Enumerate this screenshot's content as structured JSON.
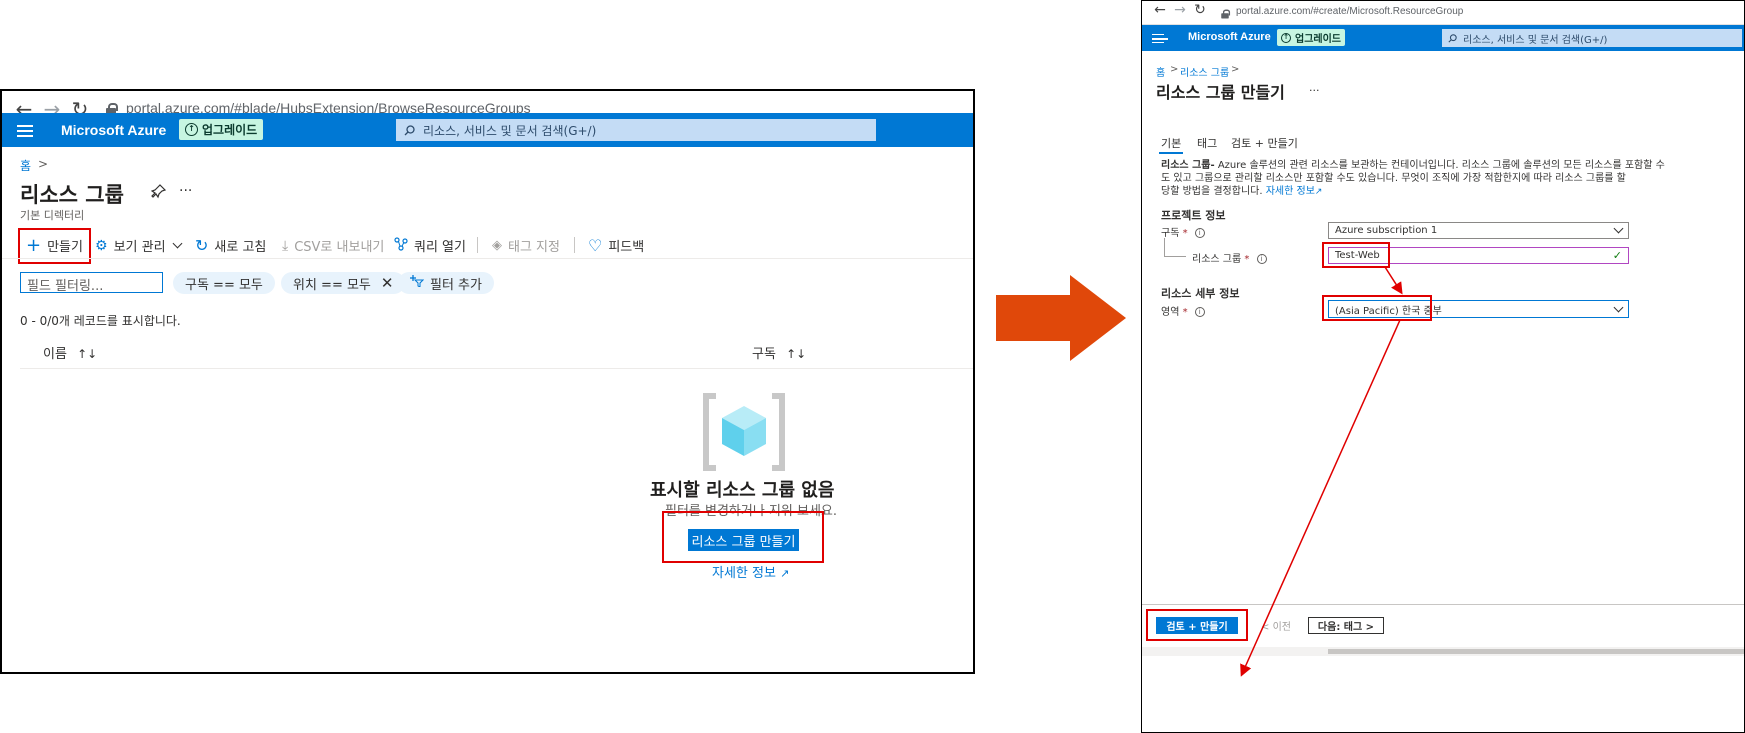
{
  "left": {
    "browser": {
      "url": "portal.azure.com/#blade/HubsExtension/BrowseResourceGroups"
    },
    "topbar": {
      "brand": "Microsoft Azure",
      "upgrade": "업그레이드",
      "search_placeholder": "리소스, 서비스 및 문서 검색(G+/)"
    },
    "breadcrumb": {
      "home": "홈",
      "sep": ">"
    },
    "title": "리소스 그룹",
    "subtitle": "기본 디렉터리",
    "ellipsis": "···",
    "toolbar": {
      "create": "만들기",
      "manage_view": "보기 관리",
      "refresh": "새로 고침",
      "export_csv": "CSV로 내보내기",
      "open_query": "쿼리 열기",
      "assign_tags": "태그 지정",
      "feedback": "피드백"
    },
    "filters": {
      "placeholder": "필드 필터링...",
      "subscription": "구독 == 모두",
      "location": "위치 == 모두",
      "add": "필터 추가"
    },
    "records": "0 - 0/0개 레코드를 표시합니다.",
    "columns": {
      "name": "이름",
      "name_sort": "↑↓",
      "subscription": "구독",
      "subscription_sort": "↑↓"
    },
    "empty": {
      "title": "표시할 리소스 그룹 없음",
      "subtitle": "필터를 변경하거나 지워 보세요.",
      "create_button": "리소스 그룹 만들기",
      "learn_more": "자세한 정보"
    }
  },
  "right": {
    "browser": {
      "url": "portal.azure.com/#create/Microsoft.ResourceGroup"
    },
    "topbar": {
      "brand": "Microsoft Azure",
      "upgrade": "업그레이드",
      "search_placeholder": "리소스, 서비스 및 문서 검색(G+/)"
    },
    "breadcrumb": {
      "home": "홈",
      "sep": ">",
      "parent": "리소스 그룹"
    },
    "title": "리소스 그룹 만들기",
    "ellipsis": "···",
    "tabs": [
      "기본",
      "태그",
      "검토 + 만들기"
    ],
    "description": {
      "lead": "리소스 그룹-",
      "line1": " Azure 솔루션의 관련 리소스를 보관하는 컨테이너입니다. 리소스 그룹에 솔루션의 모든 리소스를 포함할 수",
      "line2": "도 있고 그룹으로 관리할 리소스만 포함할 수도 있습니다. 무엇이 조직에 가장 적합한지에 따라 리소스 그룹를 할",
      "line3": "당할 방법을 결정합니다.",
      "link": "자세한 정보"
    },
    "project_section": "프로젝트 정보",
    "subscription_label": "구독",
    "subscription_value": "Azure subscription 1",
    "resource_group_label": "리소스 그룹",
    "resource_group_value": "Test-Web",
    "resource_section": "리소스 세부 정보",
    "region_label": "영역",
    "region_value": "(Asia Pacific) 한국 중부",
    "footer": {
      "review_create": "검토 + 만들기",
      "previous": "< 이전",
      "next": "다음: 태그 >"
    },
    "required_mark": "*"
  },
  "colors": {
    "azure_blue": "#0078d4",
    "highlight_red": "#e00000",
    "arrow_orange": "#e0480a"
  }
}
